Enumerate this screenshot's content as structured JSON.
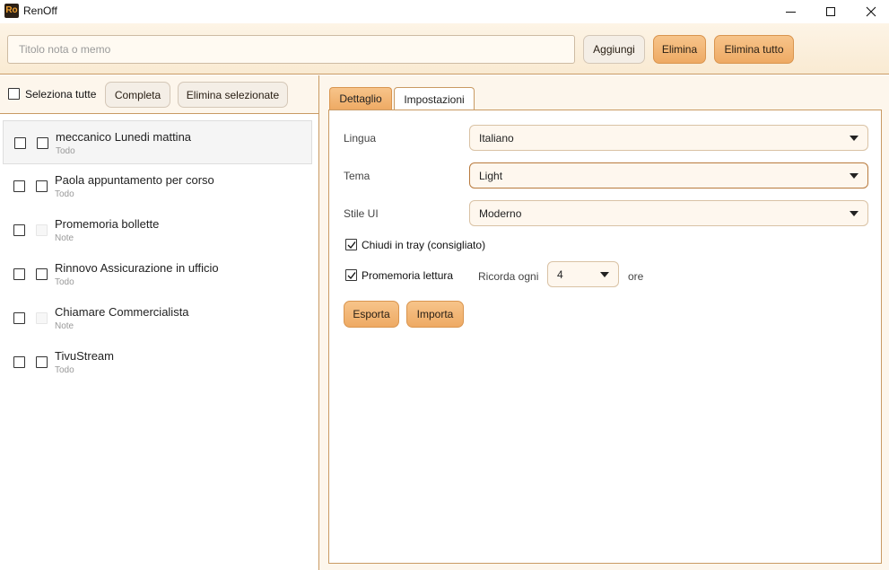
{
  "window": {
    "icon_text": "Ro",
    "title": "RenOff"
  },
  "toolbar": {
    "title_placeholder": "Titolo nota o memo",
    "title_value": "",
    "add_label": "Aggiungi",
    "delete_label": "Elimina",
    "delete_all_label": "Elimina tutto"
  },
  "list_toolbar": {
    "select_all_label": "Seleziona tutte",
    "complete_label": "Completa",
    "delete_selected_label": "Elimina selezionate"
  },
  "items": [
    {
      "title": "meccanico Lunedi mattina",
      "type": "Todo",
      "selected": true
    },
    {
      "title": "Paola appuntamento per corso",
      "type": "Todo",
      "selected": false
    },
    {
      "title": "Promemoria bollette",
      "type": "Note",
      "selected": false
    },
    {
      "title": "Rinnovo Assicurazione in ufficio",
      "type": "Todo",
      "selected": false
    },
    {
      "title": "Chiamare Commercialista",
      "type": "Note",
      "selected": false
    },
    {
      "title": "TivuStream",
      "type": "Todo",
      "selected": false
    }
  ],
  "tabs": {
    "detail_label": "Dettaglio",
    "settings_label": "Impostazioni",
    "active": "Impostazioni"
  },
  "settings": {
    "language_label": "Lingua",
    "language_value": "Italiano",
    "theme_label": "Tema",
    "theme_value": "Light",
    "ui_style_label": "Stile UI",
    "ui_style_value": "Moderno",
    "tray_label": "Chiudi in tray (consigliato)",
    "tray_checked": true,
    "reminder_label": "Promemoria lettura",
    "reminder_checked": true,
    "remind_every_label": "Ricorda ogni",
    "remind_every_value": "4",
    "hours_label": "ore",
    "export_label": "Esporta",
    "import_label": "Importa"
  },
  "colors": {
    "accent": "#eeaa64",
    "border": "#c99a63",
    "panel_bg": "#fdf6ec"
  }
}
